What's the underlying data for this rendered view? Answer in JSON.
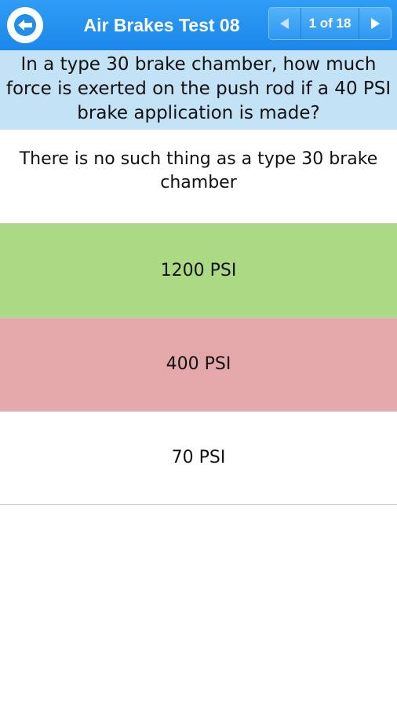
{
  "header": {
    "title": "Air Brakes Test 08",
    "pager_label": "1 of 18",
    "back_icon": "back-arrow-icon",
    "prev_icon": "triangle-left-icon",
    "next_icon": "triangle-right-icon",
    "bar_color": "#2193ef"
  },
  "question": {
    "text": "In a type 30 brake chamber, how much force is exerted on the push rod if a 40 PSI brake application is made?",
    "background": "#c3e2f5"
  },
  "answers": [
    {
      "text": "There is no such thing as a type 30 brake chamber",
      "state": "neutral",
      "color": "#ffffff"
    },
    {
      "text": "1200 PSI",
      "state": "correct",
      "color": "#acd984"
    },
    {
      "text": "400 PSI",
      "state": "incorrect",
      "color": "#e5a8aa"
    },
    {
      "text": "70 PSI",
      "state": "neutral",
      "color": "#ffffff"
    }
  ]
}
